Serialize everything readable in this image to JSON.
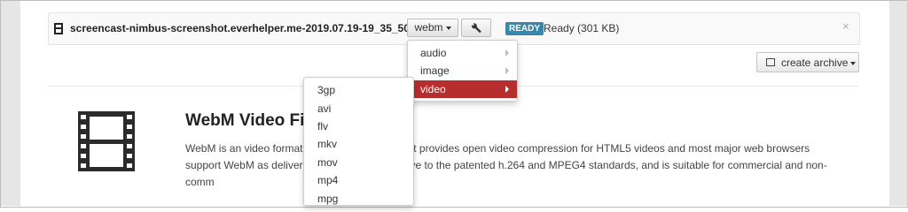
{
  "file": {
    "name": "screencast-nimbus-screenshot.everhelper.me-2019.07.19-19_35_50....",
    "format_label": "webm",
    "status_badge": "READY",
    "status_text": "Ready (301 KB)",
    "close_label": "×",
    "icon": "file-icon",
    "settings_icon": "wrench-icon"
  },
  "create_archive": {
    "label": "create archive",
    "icon": "archive-icon"
  },
  "info": {
    "title": "WebM Video Fi",
    "description": "WebM is an video format w                              o and Vorbis audio. It provides open video compression for HTML5 videos and most major web browsers support WebM as                           delivery. WebM is an alternative to the patented h.264 and MPEG4 standards, and is suitable for commercial and non-comm",
    "icon": "film-icon"
  },
  "category_menu": [
    {
      "label": "audio"
    },
    {
      "label": "image"
    },
    {
      "label": "video",
      "active": true
    }
  ],
  "video_formats": [
    "3gp",
    "avi",
    "flv",
    "mkv",
    "mov",
    "mp4",
    "mpg"
  ],
  "colors": {
    "accent": "#b52d2d",
    "badge": "#3a87ad"
  }
}
